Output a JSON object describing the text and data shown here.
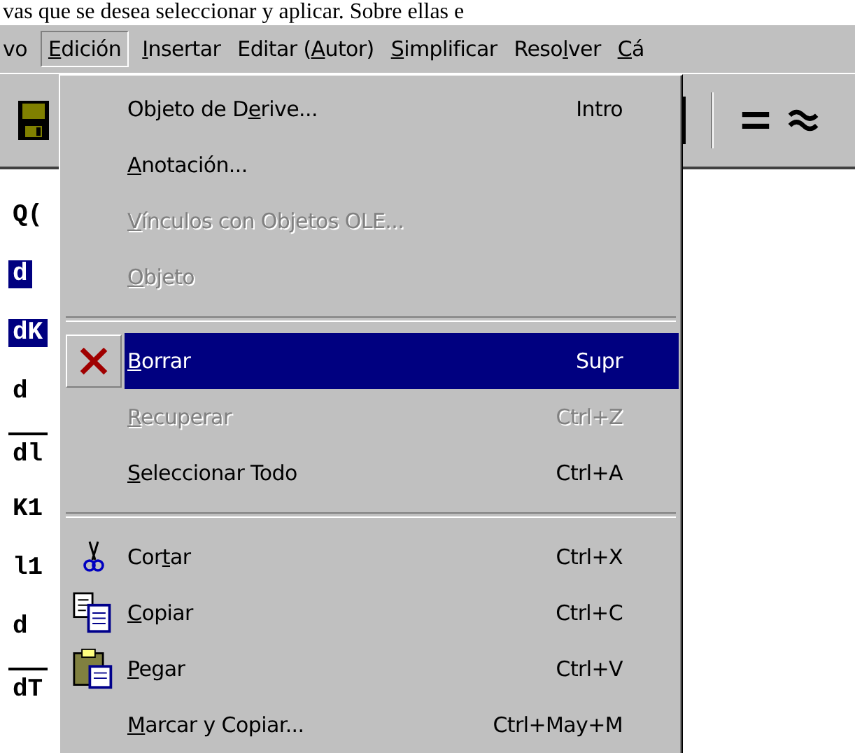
{
  "document_text": "vas que se desea seleccionar y aplicar. Sobre ellas e",
  "menubar": [
    {
      "label": {
        "post": "vo"
      },
      "selected": false
    },
    {
      "label": {
        "mnemonic": "E",
        "post": "dición"
      },
      "selected": true
    },
    {
      "label": {
        "mnemonic": "I",
        "post": "nsertar"
      },
      "selected": false
    },
    {
      "label": {
        "pre": "Editar (",
        "mnemonic": "A",
        "post": "utor)"
      },
      "selected": false
    },
    {
      "label": {
        "mnemonic": "S",
        "post": "implificar"
      },
      "selected": false
    },
    {
      "label": {
        "pre": "Reso",
        "mnemonic": "l",
        "post": "ver"
      },
      "selected": false
    },
    {
      "label": {
        "mnemonic": "C",
        "post": "á"
      },
      "selected": false
    }
  ],
  "toolbar": [
    {
      "kind": "save"
    },
    {
      "kind": "equals"
    },
    {
      "kind": "approx"
    }
  ],
  "expressions": [
    {
      "text": "Q(",
      "selected": false,
      "overline": false
    },
    {
      "text": "d",
      "selected": true,
      "overline": false
    },
    {
      "text": "dK",
      "selected": true,
      "overline": false
    },
    {
      "text": "d",
      "selected": false,
      "overline": false
    },
    {
      "text": "dl",
      "selected": false,
      "overline": true
    },
    {
      "text": "K1",
      "selected": false,
      "overline": false
    },
    {
      "text": "l1",
      "selected": false,
      "overline": false
    },
    {
      "text": "d",
      "selected": false,
      "overline": false
    },
    {
      "text": "dT",
      "selected": false,
      "overline": true
    }
  ],
  "menu": [
    {
      "kind": "item",
      "label": {
        "pre": "Objeto de D",
        "mnemonic": "e",
        "post": "rive..."
      },
      "shortcut": "Intro",
      "disabled": false,
      "selected": false
    },
    {
      "kind": "item",
      "label": {
        "mnemonic": "A",
        "post": "notación..."
      },
      "disabled": false,
      "selected": false
    },
    {
      "kind": "item",
      "label": {
        "mnemonic": "V",
        "post": "ínculos con Objetos OLE..."
      },
      "disabled": true,
      "selected": false
    },
    {
      "kind": "item",
      "label": {
        "mnemonic": "O",
        "post": "bjeto"
      },
      "disabled": true,
      "selected": false
    },
    {
      "kind": "separator"
    },
    {
      "kind": "delete",
      "label": {
        "mnemonic": "B",
        "post": "orrar"
      },
      "shortcut": "Supr",
      "disabled": false,
      "selected": true
    },
    {
      "kind": "item",
      "label": {
        "mnemonic": "R",
        "post": "ecuperar"
      },
      "shortcut": "Ctrl+Z",
      "disabled": true,
      "selected": false
    },
    {
      "kind": "item",
      "label": {
        "mnemonic": "S",
        "post": "eleccionar Todo"
      },
      "shortcut": "Ctrl+A",
      "disabled": false,
      "selected": false
    },
    {
      "kind": "separator"
    },
    {
      "kind": "cut",
      "label": {
        "pre": "Cor",
        "mnemonic": "t",
        "post": "ar"
      },
      "shortcut": "Ctrl+X",
      "disabled": false,
      "selected": false
    },
    {
      "kind": "copy",
      "label": {
        "mnemonic": "C",
        "post": "opiar"
      },
      "shortcut": "Ctrl+C",
      "disabled": false,
      "selected": false
    },
    {
      "kind": "paste",
      "label": {
        "mnemonic": "P",
        "post": "egar"
      },
      "shortcut": "Ctrl+V",
      "disabled": false,
      "selected": false
    },
    {
      "kind": "item",
      "label": {
        "mnemonic": "M",
        "post": "arcar y Copiar..."
      },
      "shortcut": "Ctrl+May+M",
      "disabled": false,
      "selected": false
    }
  ]
}
